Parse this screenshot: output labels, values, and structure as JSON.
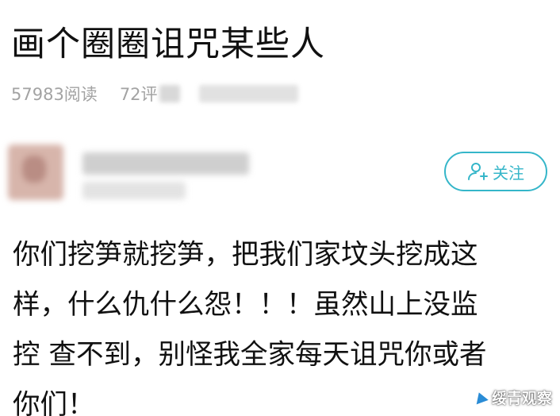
{
  "post": {
    "title": "画个圈圈诅咒某些人",
    "reads": "57983阅读",
    "comments": "72评"
  },
  "author": {
    "follow_label": "关注",
    "follow_icon": "add-user-icon",
    "accent_color": "#35b6c9"
  },
  "content": {
    "lines": [
      "你们挖笋就挖笋，把我们家坟头挖成这",
      "样，什么仇什么怨！！！虽然山上没监",
      "控 查不到，别怪我全家每天诅咒你或者",
      "你们！"
    ]
  },
  "watermark": {
    "text": "绥青观察",
    "icon": "bird-logo-icon"
  }
}
